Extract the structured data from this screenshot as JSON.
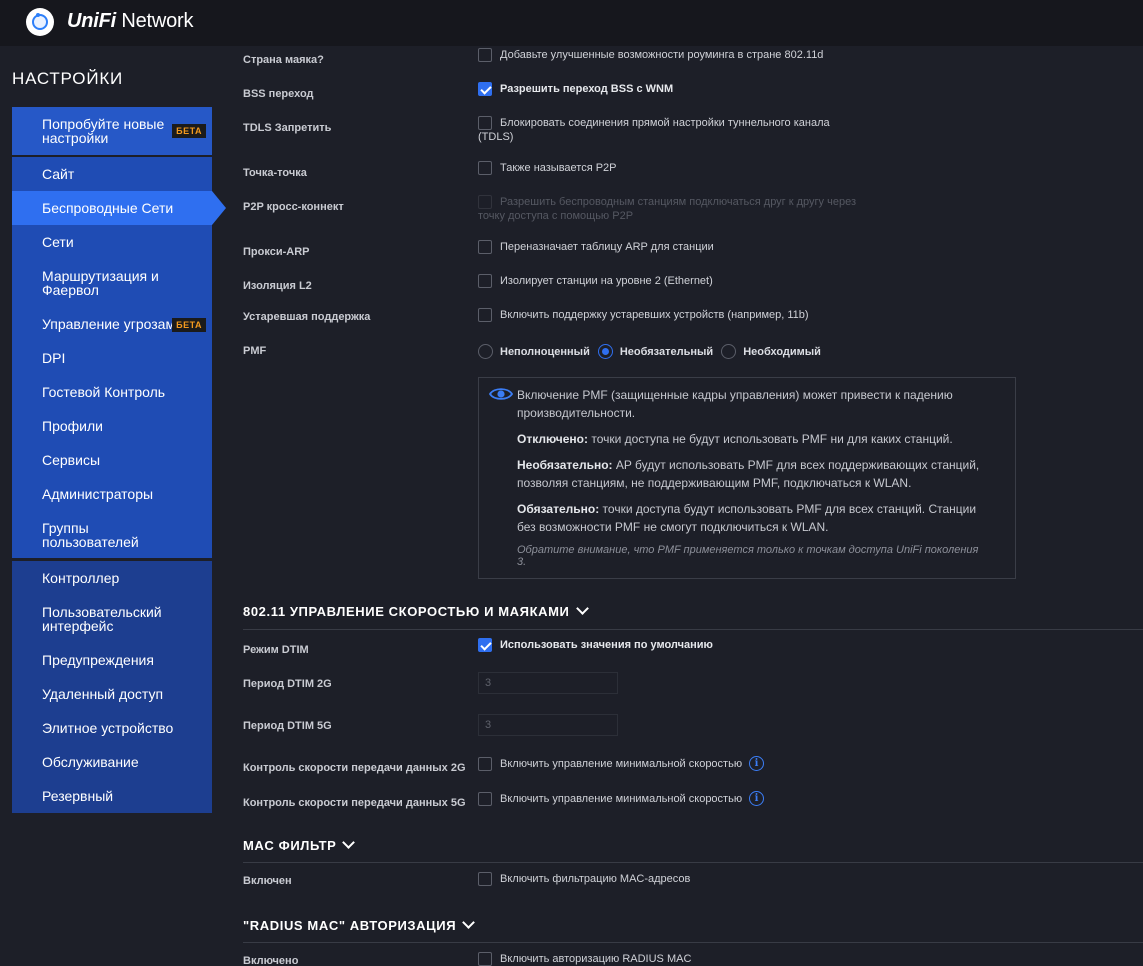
{
  "app": {
    "brand_italic": "UniFi",
    "brand_rest": "Network"
  },
  "sidebar": {
    "title": "НАСТРОЙКИ",
    "beta_label": "БЕТА",
    "items": [
      {
        "label": "Попробуйте новые настройки"
      },
      {
        "label": "Сайт"
      },
      {
        "label": "Беспроводные Сети"
      },
      {
        "label": "Сети"
      },
      {
        "label": "Маршрутизация и Фаервол"
      },
      {
        "label": "Управление угрозами"
      },
      {
        "label": "DPI"
      },
      {
        "label": "Гостевой Контроль"
      },
      {
        "label": "Профили"
      },
      {
        "label": "Сервисы"
      },
      {
        "label": "Администраторы"
      },
      {
        "label": "Группы пользователей"
      },
      {
        "label": "Контроллер"
      },
      {
        "label": "Пользовательский интерфейс"
      },
      {
        "label": "Предупреждения"
      },
      {
        "label": "Удаленный доступ"
      },
      {
        "label": "Элитное устройство"
      },
      {
        "label": "Обслуживание"
      },
      {
        "label": "Резервный"
      }
    ],
    "active_item": "Беспроводные Сети"
  },
  "settings": [
    {
      "label": "Страна маяка?",
      "option": "Добавьте улучшенные возможности роуминга в стране 802.11d",
      "checked": false
    },
    {
      "label": "BSS переход",
      "option": "Разрешить переход BSS с WNM",
      "checked": true
    },
    {
      "label": "TDLS Запретить",
      "option": "Блокировать соединения прямой настройки туннельного канала",
      "option_line2": "(TDLS)",
      "checked": false
    },
    {
      "label": "Точка-точка",
      "option": "Также называется P2P",
      "checked": false
    },
    {
      "label": "P2P кросс-коннект",
      "option": "Разрешить беспроводным станциям подключаться друг к другу через",
      "option_line2": "точку доступа с помощью P2P",
      "checked": false,
      "disabled": true
    },
    {
      "label": "Прокси-ARP",
      "option": "Переназначает таблицу ARP для станции",
      "checked": false
    },
    {
      "label": "Изоляция L2",
      "option": "Изолирует станции на уровне 2 (Ethernet)",
      "checked": false
    },
    {
      "label": "Устаревшая поддержка",
      "option": "Включить поддержку устаревших устройств (например, 11b)",
      "checked": false
    }
  ],
  "pmf": {
    "label": "PMF",
    "options": [
      "Неполноценный",
      "Необязательный",
      "Необходимый"
    ],
    "selected": "Необязательный",
    "info": {
      "intro": "Включение PMF (защищенные кадры управления) может привести к падению производительности.",
      "off_title": "Отключено:",
      "off_text": "точки доступа не будут использовать PMF ни для каких станций.",
      "optional_title": "Необязательно:",
      "optional_text": "AP будут использовать PMF для всех поддерживающих станций, позволяя станциям, не поддерживающим PMF, подключаться к WLAN.",
      "required_title": "Обязательно:",
      "required_text": "точки доступа будут использовать PMF для всех станций. Станции без возможности PMF не смогут подключиться к WLAN.",
      "note": "Обратите внимание, что PMF применяется только к точкам доступа UniFi поколения 3."
    }
  },
  "rate_section": {
    "title": "802.11 УПРАВЛЕНИЕ СКОРОСТЬЮ И МАЯКАМИ",
    "dtim_mode_label": "Режим DTIM",
    "dtim_mode_option": "Использовать значения по умолчанию",
    "dtim_mode_checked": true,
    "dtim_2g_label": "Период DTIM 2G",
    "dtim_2g_value": "3",
    "dtim_5g_label": "Период DTIM 5G",
    "dtim_5g_value": "3",
    "rate_2g_label": "Контроль скорости передачи данных 2G",
    "rate_2g_option": "Включить управление минимальной скоростью",
    "rate_5g_label": "Контроль скорости передачи данных 5G",
    "rate_5g_option": "Включить управление минимальной скоростью"
  },
  "mac_section": {
    "title": "MAC ФИЛЬТР",
    "enabled_label": "Включен",
    "enabled_option": "Включить фильтрацию MAC-адресов"
  },
  "radius_section": {
    "title": "\"RADIUS MAC\" АВТОРИЗАЦИЯ",
    "enabled_label": "Включено",
    "enabled_option": "Включить авторизацию RADIUS MAC"
  },
  "colors": {
    "accent": "#2f6ff0",
    "beta": "#f39a1e",
    "background": "#1d1f28"
  }
}
